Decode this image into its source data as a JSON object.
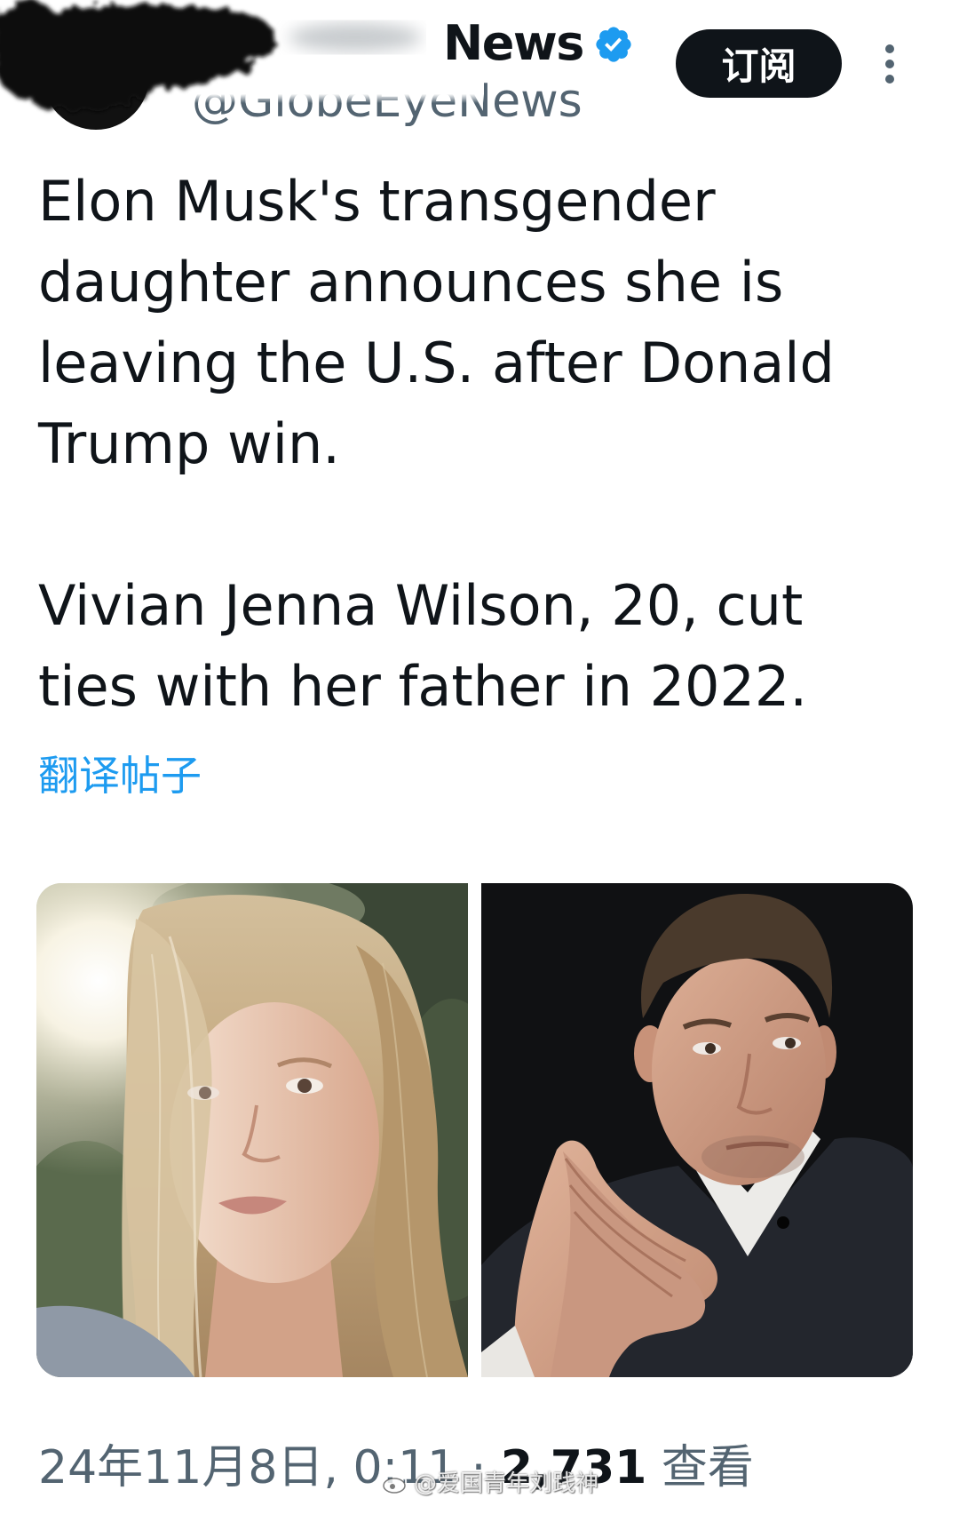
{
  "header": {
    "display_name": "News",
    "handle": "@GlobeEyeNews",
    "verified_badge_icon": "verified-badge-icon",
    "subscribe_label": "订阅",
    "more_icon": "more-vertical-icon"
  },
  "tweet": {
    "paragraphs": [
      "Elon Musk's transgender daughter announces she is leaving the U.S. after Donald Trump win.",
      "Vivian Jenna Wilson, 20, cut ties with her father in 2022."
    ],
    "translate_label": "翻译帖子"
  },
  "meta": {
    "timestamp": "24年11月8日, 0:11",
    "separator": "·",
    "views_count": "2,731",
    "views_label": "查看"
  },
  "watermark": {
    "icon": "weibo-logo-icon",
    "text": "@爱国青年刘践神"
  },
  "colors": {
    "text_primary": "#0f1419",
    "text_secondary": "#536471",
    "accent": "#1d9bf0",
    "button_bg": "#0f1419",
    "button_text": "#ffffff",
    "verified_badge": "#1d9bf0"
  }
}
